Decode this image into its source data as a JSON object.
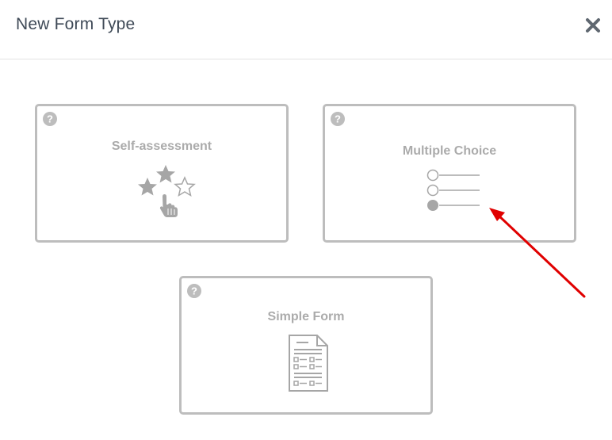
{
  "dialog": {
    "title": "New Form Type",
    "close_icon": "close-icon"
  },
  "cards": [
    {
      "label": "Self-assessment",
      "icon": "stars-hand-icon"
    },
    {
      "label": "Multiple Choice",
      "icon": "radio-list-icon"
    },
    {
      "label": "Simple Form",
      "icon": "form-document-icon"
    }
  ],
  "colors": {
    "title": "#3f4a57",
    "card_border": "#bdbdbd",
    "card_text": "#ababab",
    "arrow": "#e00000"
  }
}
